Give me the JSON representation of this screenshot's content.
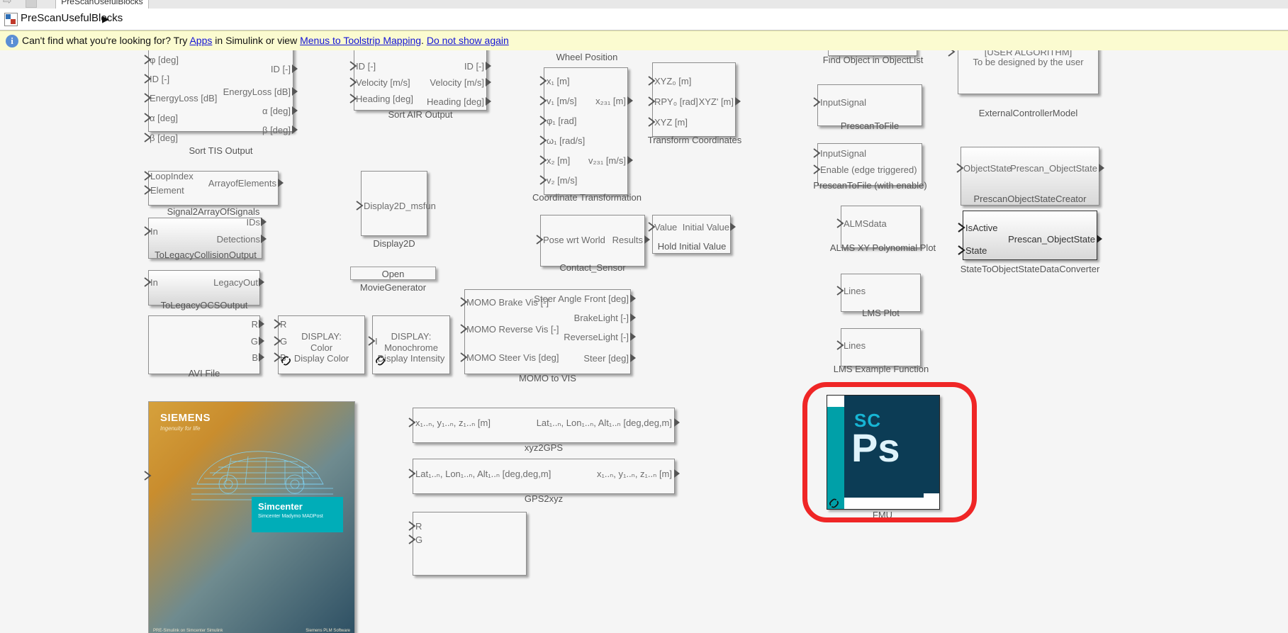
{
  "window": {
    "tab_label": "PreScanUsefulBlocks",
    "breadcrumb_label": "PreScanUsefulBlocks",
    "breadcrumb_arrow": "▶"
  },
  "notification": {
    "prefix": "Can't find what you're looking for? Try ",
    "link_apps": "Apps",
    "mid": " in Simulink or view ",
    "link_mapping": "Menus to Toolstrip Mapping",
    "dot": ". ",
    "link_dismiss": "Do not show again"
  },
  "blocks": [
    {
      "id": "sort-tis-output",
      "caption": "Sort TIS Output",
      "inputs": [
        "φ [deg]",
        "ID [-]",
        "EnergyLoss [dB]",
        "α [deg]",
        "β [deg]"
      ],
      "outputs": [
        "ID [-]",
        "EnergyLoss [dB]",
        "α [deg]",
        "β [deg]"
      ]
    },
    {
      "id": "signal2arrayofsignals",
      "caption": "Signal2ArrayOfSignals",
      "inputs": [
        "LoopIndex",
        "Element"
      ],
      "outputs": [
        "ArrayofElements"
      ]
    },
    {
      "id": "tolegacycollisionoutput",
      "caption": "ToLegacyCollisionOutput",
      "inputs": [
        "In"
      ],
      "outputs": [
        "IDs",
        "Detections"
      ]
    },
    {
      "id": "tolegacyocsoutput",
      "caption": "ToLegacyOCSOutput",
      "inputs": [
        "In"
      ],
      "outputs": [
        "LegacyOut"
      ]
    },
    {
      "id": "avi-file",
      "caption": "AVI File",
      "inputs": [],
      "outputs": [
        "R",
        "G",
        "B"
      ]
    },
    {
      "id": "display-color",
      "caption": "",
      "title_lines": [
        "DISPLAY:",
        "Color",
        "Display Color"
      ],
      "inputs": [
        "R",
        "G",
        "B"
      ],
      "outputs": []
    },
    {
      "id": "display-monochrome",
      "caption": "",
      "title_lines": [
        "DISPLAY:",
        "Monochrome",
        "Display Intensity"
      ],
      "inputs": [
        "I"
      ],
      "outputs": []
    },
    {
      "id": "sort-air-output",
      "caption": "Sort AIR Output",
      "inputs": [
        "ID [-]",
        "Velocity [m/s]",
        "Heading [deg]"
      ],
      "outputs": [
        "ID [-]",
        "Velocity [m/s]",
        "Heading [deg]"
      ]
    },
    {
      "id": "display2d",
      "caption": "Display2D",
      "inputs": [
        "Display2D_msfun"
      ],
      "outputs": []
    },
    {
      "id": "open-moviegenerator",
      "caption": "",
      "label": "Open MovieGenerator"
    },
    {
      "id": "coordinate-transformation",
      "caption": "Coordinate Transformation",
      "header": "Wheel Position",
      "inputs": [
        "x₁ [m]",
        "v₁ [m/s]",
        "φ₁ [rad]",
        "ω₁ [rad/s]",
        "x₂ [m]",
        "v₂ [m/s]"
      ],
      "outputs": [
        "x₂₃₁ [m]",
        "v₂₃₁ [m/s]"
      ]
    },
    {
      "id": "contact-sensor",
      "caption": "Contact_Sensor",
      "inputs": [
        "Pose wrt World"
      ],
      "outputs": [
        "Results"
      ]
    },
    {
      "id": "momo-to-vis",
      "caption": "MOMO to VIS",
      "inputs": [
        "MOMO Brake Vis [-]",
        "MOMO Reverse Vis [-]",
        "MOMO Steer Vis [deg]"
      ],
      "outputs": [
        "Steer Angle Front [deg]",
        "BrakeLight [-]",
        "ReverseLight [-]",
        "Steer [deg]"
      ]
    },
    {
      "id": "xyz2gps",
      "caption": "xyz2GPS",
      "inputs": [
        "x₁..ₙ, y₁..ₙ, z₁..ₙ [m]"
      ],
      "outputs": [
        "Lat₁..ₙ, Lon₁..ₙ, Alt₁..ₙ [deg,deg,m]"
      ]
    },
    {
      "id": "gps2xyz",
      "caption": "GPS2xyz",
      "inputs": [
        "Lat₁..ₙ, Lon₁..ₙ, Alt₁..ₙ [deg,deg,m]"
      ],
      "outputs": [
        "x₁..ₙ, y₁..ₙ, z₁..ₙ [m]"
      ]
    },
    {
      "id": "rgb-bottom",
      "caption": "",
      "inputs": [],
      "outputs": [
        "R",
        "G"
      ]
    },
    {
      "id": "transform-coordinates",
      "caption": "Transform Coordinates",
      "inputs": [
        "XYZ₀ [m]",
        "RPY₀ [rad]",
        "XYZ [m]"
      ],
      "outputs": [
        "XYZ' [m]"
      ]
    },
    {
      "id": "hold-initial-value",
      "caption": "Hold Initial Value",
      "inputs": [
        "Value"
      ],
      "outputs": [
        "Initial Value"
      ]
    },
    {
      "id": "find-object-in-objectlist",
      "caption": "Find Object in ObjectList",
      "inputs": [],
      "outputs": []
    },
    {
      "id": "prescantofile",
      "caption": "PrescanToFile",
      "inputs": [
        "InputSignal"
      ],
      "outputs": []
    },
    {
      "id": "prescantofile-enable",
      "caption": "PrescanToFile (with enable)",
      "inputs": [
        "InputSignal",
        "Enable (edge triggered)"
      ],
      "outputs": []
    },
    {
      "id": "alms-xy-polynomial-plot",
      "caption": "ALMS XY Polynomial Plot",
      "inputs": [
        "ALMSdata"
      ],
      "outputs": []
    },
    {
      "id": "lms-plot",
      "caption": "LMS Plot",
      "inputs": [
        "Lines"
      ],
      "outputs": []
    },
    {
      "id": "lms-example-function",
      "caption": "LMS Example Function",
      "inputs": [
        "Lines"
      ],
      "outputs": []
    },
    {
      "id": "externalcontrollermodel",
      "caption": "ExternalControllerModel",
      "title_lines": [
        "[USER ALGORITHM]",
        "To be designed by the user"
      ],
      "inputs": [
        ""
      ],
      "outputs": [
        ""
      ]
    },
    {
      "id": "prescanobjectstatecreator",
      "caption": "PrescanObjectStateCreator",
      "inputs": [
        "ObjectState"
      ],
      "outputs": [
        "Prescan_ObjectState"
      ]
    },
    {
      "id": "statetoobjectstatedataconverter",
      "caption": "StateToObjectStateDataConverter",
      "inputs": [
        "IsActive",
        "State"
      ],
      "outputs": [
        "Prescan_ObjectState"
      ]
    },
    {
      "id": "fmu",
      "caption": "FMU",
      "tile_sc": "SC",
      "tile_ps": "Ps"
    }
  ],
  "siemens_image": {
    "logo": "SIEMENS",
    "tagline": "Ingenuity for life",
    "band_title": "Simcenter",
    "band_sub": "Simcenter Madymo MADPost",
    "footer_left": "PRE-Simulink on Simcenter Simulink",
    "footer_right": "Siemens PLM Software"
  },
  "colors": {
    "annotation": "#ef2626",
    "notify_bg": "#fbfbd0",
    "link": "#1414d6",
    "fmu_navy": "#0c3c55",
    "fmu_teal": "#00a0a8"
  }
}
